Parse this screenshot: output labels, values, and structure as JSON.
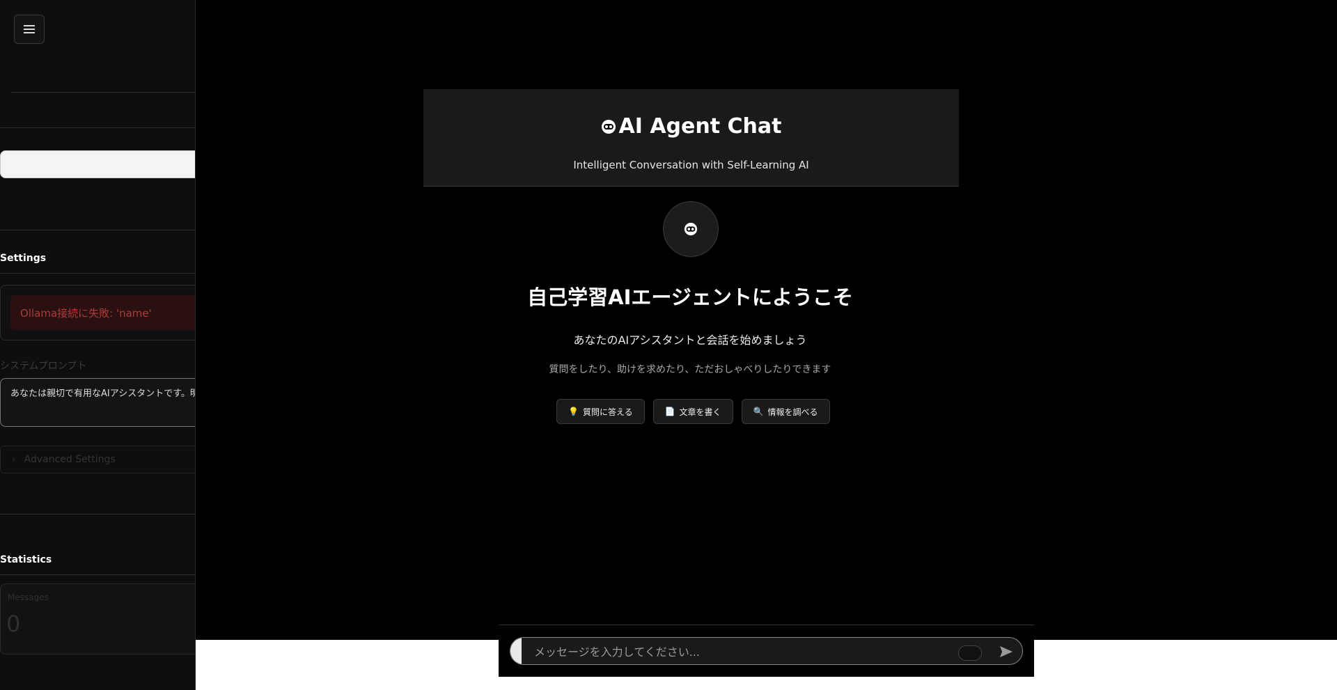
{
  "sidebar": {
    "settings_heading": "Settings",
    "error_message": "Ollama接続に失敗: 'name'",
    "system_prompt_label": "システムプロンプト",
    "system_prompt_value": "あなたは親切で有用なAIアシスタントです。明",
    "advanced_settings_label": "Advanced Settings",
    "statistics_heading": "Statistics",
    "messages_label": "Messages",
    "messages_value": "0"
  },
  "header": {
    "title": "AI Agent Chat",
    "subtitle": "Intelligent Conversation with Self-Learning AI"
  },
  "welcome": {
    "title": "自己学習AIエージェントにようこそ",
    "subtitle": "あなたのAIアシスタントと会話を始めましょう",
    "description": "質問をしたり、助けを求めたり、ただおしゃべりしたりできます"
  },
  "chips": [
    {
      "label": "質問に答える",
      "icon": "lightbulb-icon"
    },
    {
      "label": "文章を書く",
      "icon": "document-icon"
    },
    {
      "label": "情報を調べる",
      "icon": "magnifier-icon"
    }
  ],
  "chat": {
    "placeholder": "メッセージを入力してください..."
  }
}
